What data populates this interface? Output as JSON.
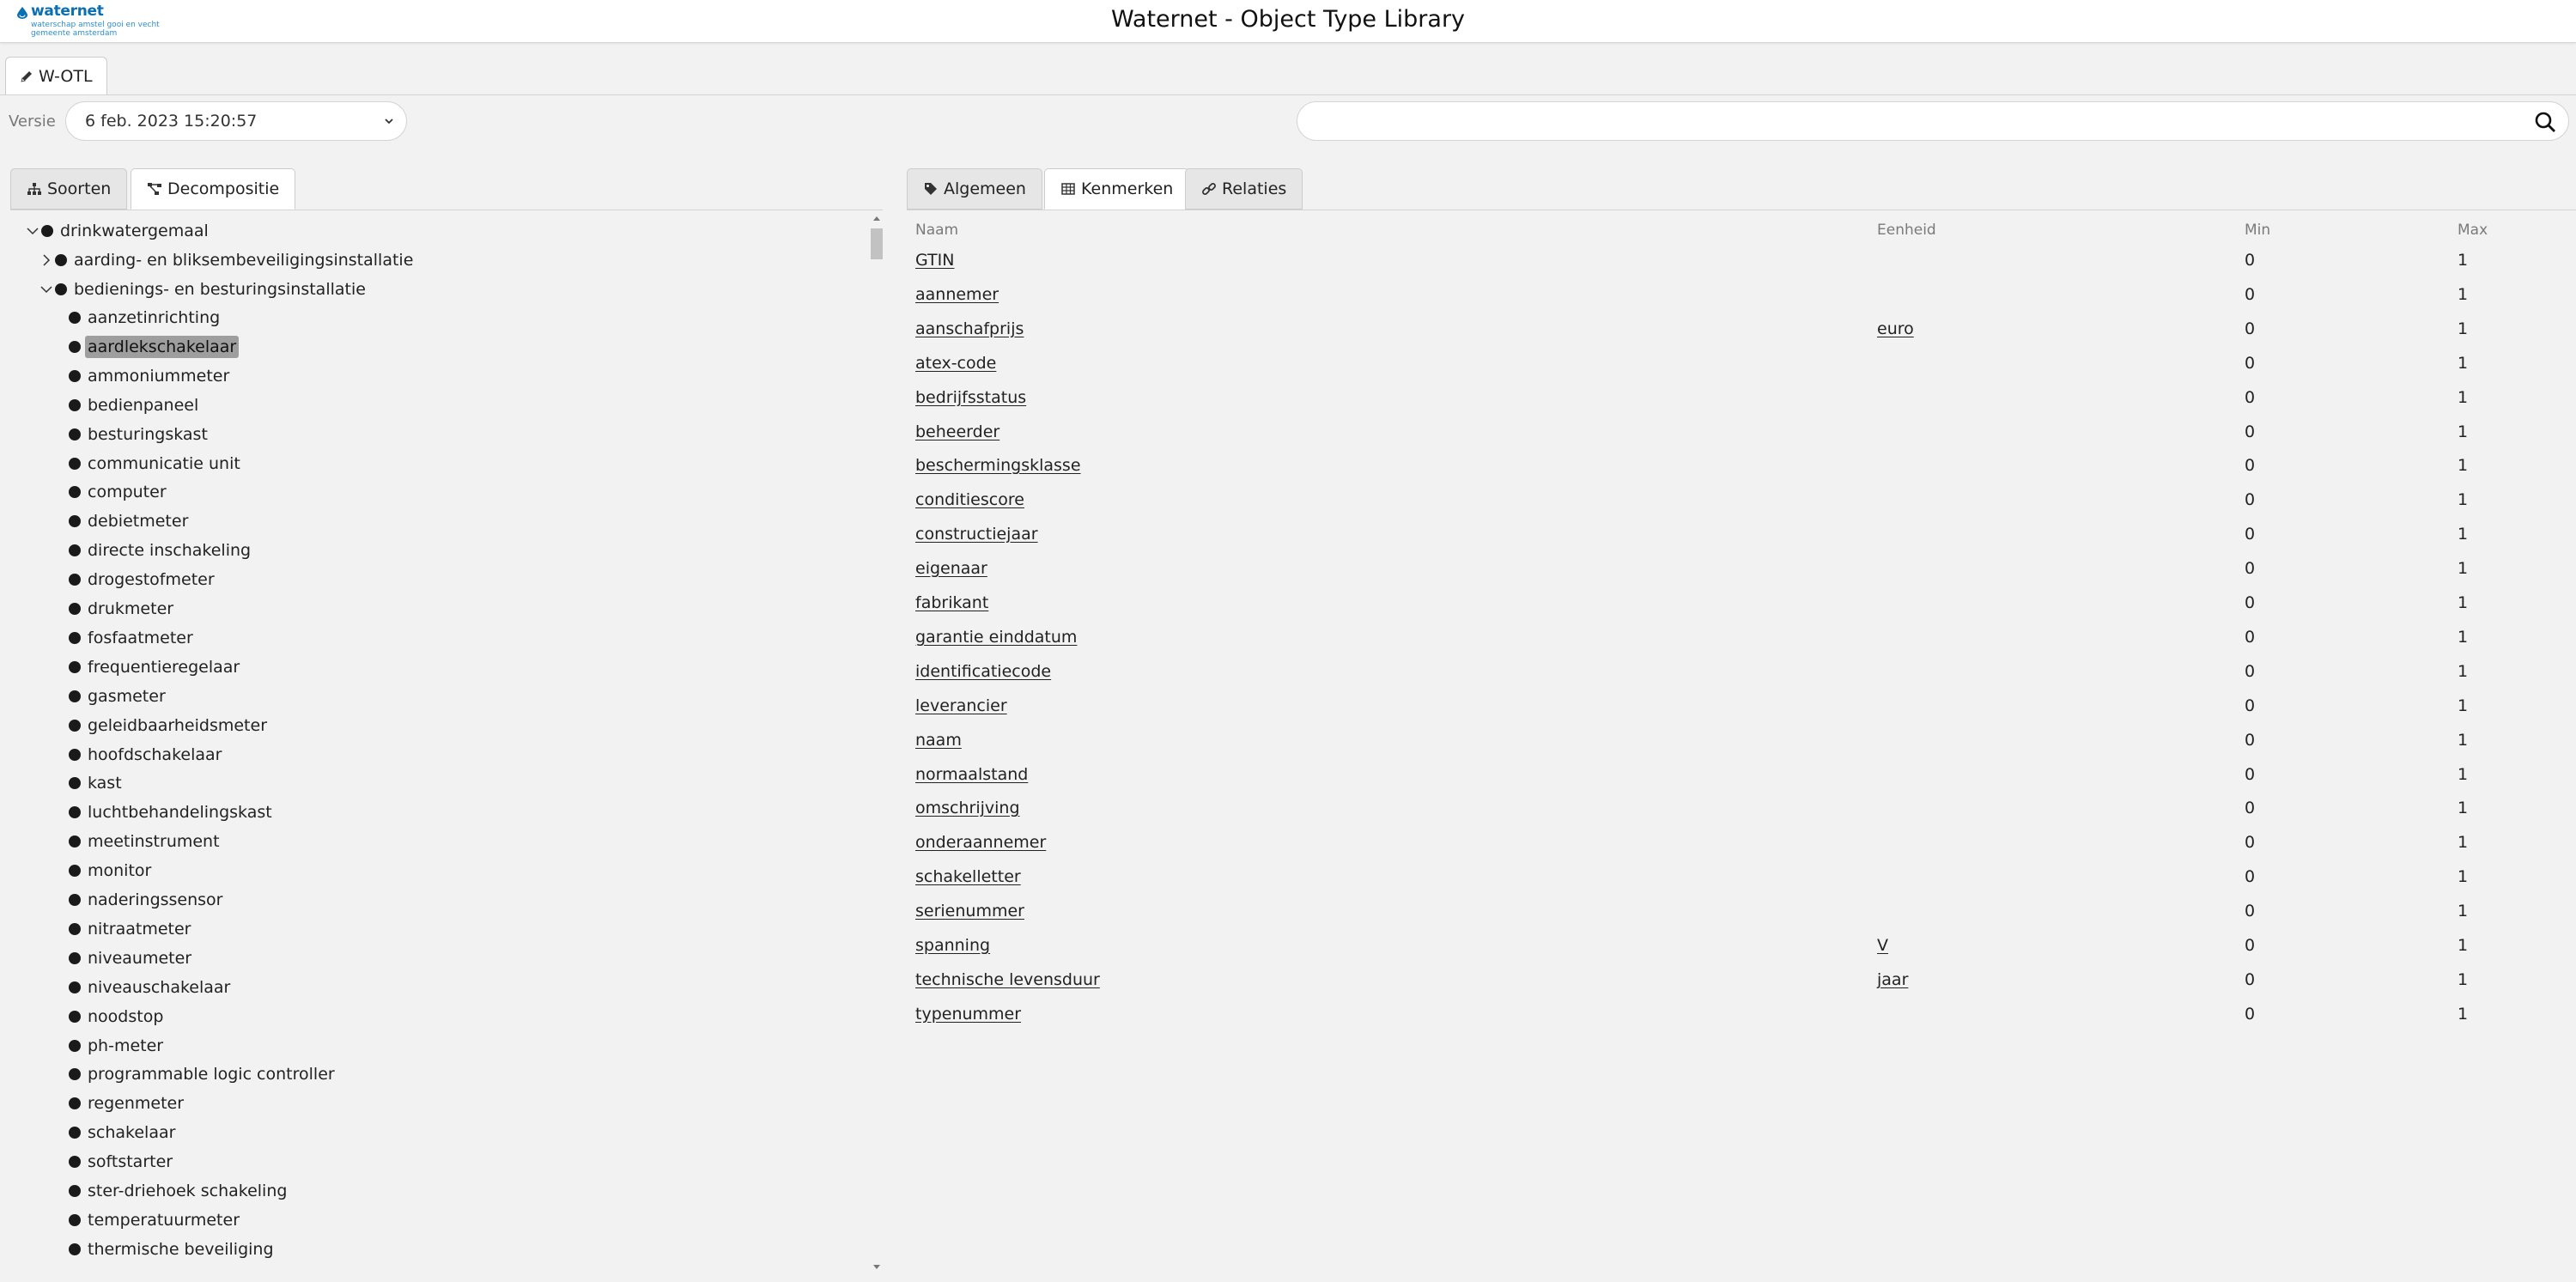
{
  "header": {
    "logo_word": "waternet",
    "logo_sub_1": "waterschap amstel gooi en vecht",
    "logo_sub_2": "gemeente amsterdam",
    "title": "Waternet - Object Type Library"
  },
  "main_tab": {
    "label": "W-OTL",
    "icon": "pencil-icon"
  },
  "versie": {
    "label": "Versie",
    "value": "6 feb. 2023 15:20:57"
  },
  "search": {
    "value": "",
    "placeholder": ""
  },
  "left_tabs": [
    {
      "label": "Soorten",
      "icon": "sitemap-icon"
    },
    {
      "label": "Decompositie",
      "icon": "tree-icon"
    }
  ],
  "right_tabs": [
    {
      "label": "Algemeen",
      "icon": "tag-icon"
    },
    {
      "label": "Kenmerken",
      "icon": "table-icon"
    },
    {
      "label": "Relaties",
      "icon": "link-icon"
    }
  ],
  "tree": {
    "root": "drinkwatergemaal",
    "children": [
      "aarding- en bliksembeveiligingsinstallatie",
      "bedienings- en besturingsinstallatie"
    ],
    "items": [
      "aanzetinrichting",
      "aardlekschakelaar",
      "ammoniummeter",
      "bedienpaneel",
      "besturingskast",
      "communicatie unit",
      "computer",
      "debietmeter",
      "directe inschakeling",
      "drogestofmeter",
      "drukmeter",
      "fosfaatmeter",
      "frequentieregelaar",
      "gasmeter",
      "geleidbaarheidsmeter",
      "hoofdschakelaar",
      "kast",
      "luchtbehandelingskast",
      "meetinstrument",
      "monitor",
      "naderingssensor",
      "nitraatmeter",
      "niveaumeter",
      "niveauschakelaar",
      "noodstop",
      "ph-meter",
      "programmable logic controller",
      "regenmeter",
      "schakelaar",
      "softstarter",
      "ster-driehoek schakeling",
      "temperatuurmeter",
      "thermische beveiliging"
    ],
    "selected": "aardlekschakelaar"
  },
  "table": {
    "headers": [
      "Naam",
      "Eenheid",
      "Min",
      "Max"
    ],
    "rows": [
      [
        "GTIN",
        "",
        "0",
        "1"
      ],
      [
        "aannemer",
        "",
        "0",
        "1"
      ],
      [
        "aanschafprijs",
        "euro",
        "0",
        "1"
      ],
      [
        "atex-code",
        "",
        "0",
        "1"
      ],
      [
        "bedrijfsstatus",
        "",
        "0",
        "1"
      ],
      [
        "beheerder",
        "",
        "0",
        "1"
      ],
      [
        "beschermingsklasse",
        "",
        "0",
        "1"
      ],
      [
        "conditiescore",
        "",
        "0",
        "1"
      ],
      [
        "constructiejaar",
        "",
        "0",
        "1"
      ],
      [
        "eigenaar",
        "",
        "0",
        "1"
      ],
      [
        "fabrikant",
        "",
        "0",
        "1"
      ],
      [
        "garantie einddatum",
        "",
        "0",
        "1"
      ],
      [
        "identificatiecode",
        "",
        "0",
        "1"
      ],
      [
        "leverancier",
        "",
        "0",
        "1"
      ],
      [
        "naam",
        "",
        "0",
        "1"
      ],
      [
        "normaalstand",
        "",
        "0",
        "1"
      ],
      [
        "omschrijving",
        "",
        "0",
        "1"
      ],
      [
        "onderaannemer",
        "",
        "0",
        "1"
      ],
      [
        "schakelletter",
        "",
        "0",
        "1"
      ],
      [
        "serienummer",
        "",
        "0",
        "1"
      ],
      [
        "spanning",
        "V",
        "0",
        "1"
      ],
      [
        "technische levensduur",
        "jaar",
        "0",
        "1"
      ],
      [
        "typenummer",
        "",
        "0",
        "1"
      ]
    ]
  },
  "colors": {
    "background": "#f2f2f2",
    "brand_blue": "#0a6fb3",
    "selected_bg": "#9e9e9e"
  }
}
